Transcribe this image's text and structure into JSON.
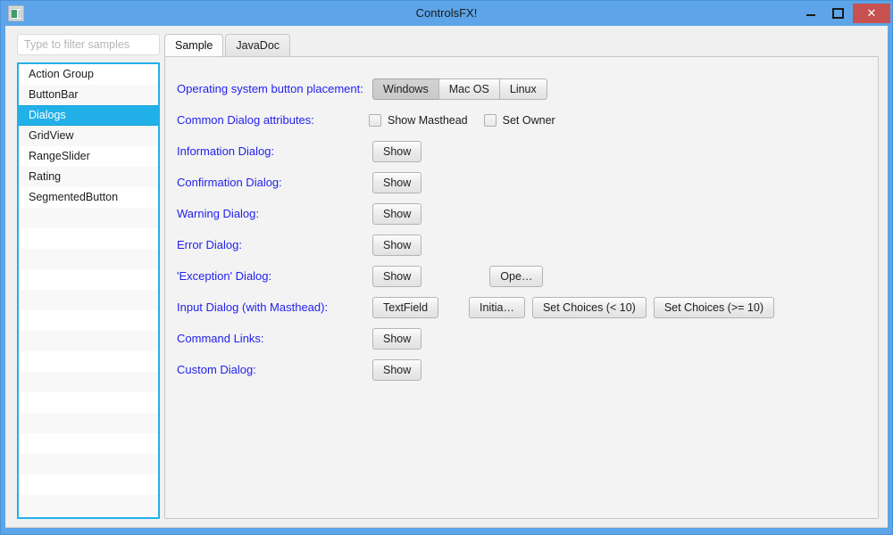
{
  "window": {
    "title": "ControlsFX!",
    "icon_name": "app-icon",
    "controls": {
      "minimize_label": "–",
      "maximize_label": "☐",
      "close_label": "✕"
    },
    "accent_blue": "#5da5e8",
    "close_red": "#c75050"
  },
  "sidebar": {
    "filter": {
      "placeholder": "Type to filter samples",
      "value": ""
    },
    "items": [
      {
        "label": "Action Group",
        "selected": false
      },
      {
        "label": "ButtonBar",
        "selected": false
      },
      {
        "label": "Dialogs",
        "selected": true
      },
      {
        "label": "GridView",
        "selected": false
      },
      {
        "label": "RangeSlider",
        "selected": false
      },
      {
        "label": "Rating",
        "selected": false
      },
      {
        "label": "SegmentedButton",
        "selected": false
      }
    ],
    "selection_color": "#22b0e8"
  },
  "tabs": [
    {
      "label": "Sample",
      "active": true
    },
    {
      "label": "JavaDoc",
      "active": false
    }
  ],
  "form": {
    "label_color": "#2222ee",
    "rows": [
      {
        "label": "Operating system button placement:",
        "type": "segmented",
        "options": [
          {
            "label": "Windows",
            "selected": true
          },
          {
            "label": "Mac OS",
            "selected": false
          },
          {
            "label": "Linux",
            "selected": false
          }
        ]
      },
      {
        "label": "Common Dialog attributes:",
        "type": "checkboxes",
        "checkboxes": [
          {
            "label": "Show Masthead",
            "checked": false
          },
          {
            "label": "Set Owner",
            "checked": false
          }
        ]
      },
      {
        "label": "Information Dialog:",
        "type": "buttons",
        "buttons": [
          {
            "label": "Show"
          }
        ]
      },
      {
        "label": "Confirmation Dialog:",
        "type": "buttons",
        "buttons": [
          {
            "label": "Show"
          }
        ]
      },
      {
        "label": "Warning Dialog:",
        "type": "buttons",
        "buttons": [
          {
            "label": "Show"
          }
        ]
      },
      {
        "label": "Error Dialog:",
        "type": "buttons",
        "buttons": [
          {
            "label": "Show"
          }
        ]
      },
      {
        "label": "'Exception' Dialog:",
        "type": "buttons",
        "buttons": [
          {
            "label": "Show"
          },
          {
            "label": "Ope…"
          }
        ]
      },
      {
        "label": "Input Dialog (with Masthead):",
        "type": "buttons",
        "buttons": [
          {
            "label": "TextField"
          },
          {
            "label": "Initia…"
          },
          {
            "label": "Set Choices (< 10)"
          },
          {
            "label": "Set Choices (>= 10)"
          }
        ]
      },
      {
        "label": "Command Links:",
        "type": "buttons",
        "buttons": [
          {
            "label": "Show"
          }
        ]
      },
      {
        "label": "Custom Dialog:",
        "type": "buttons",
        "buttons": [
          {
            "label": "Show"
          }
        ]
      }
    ]
  }
}
